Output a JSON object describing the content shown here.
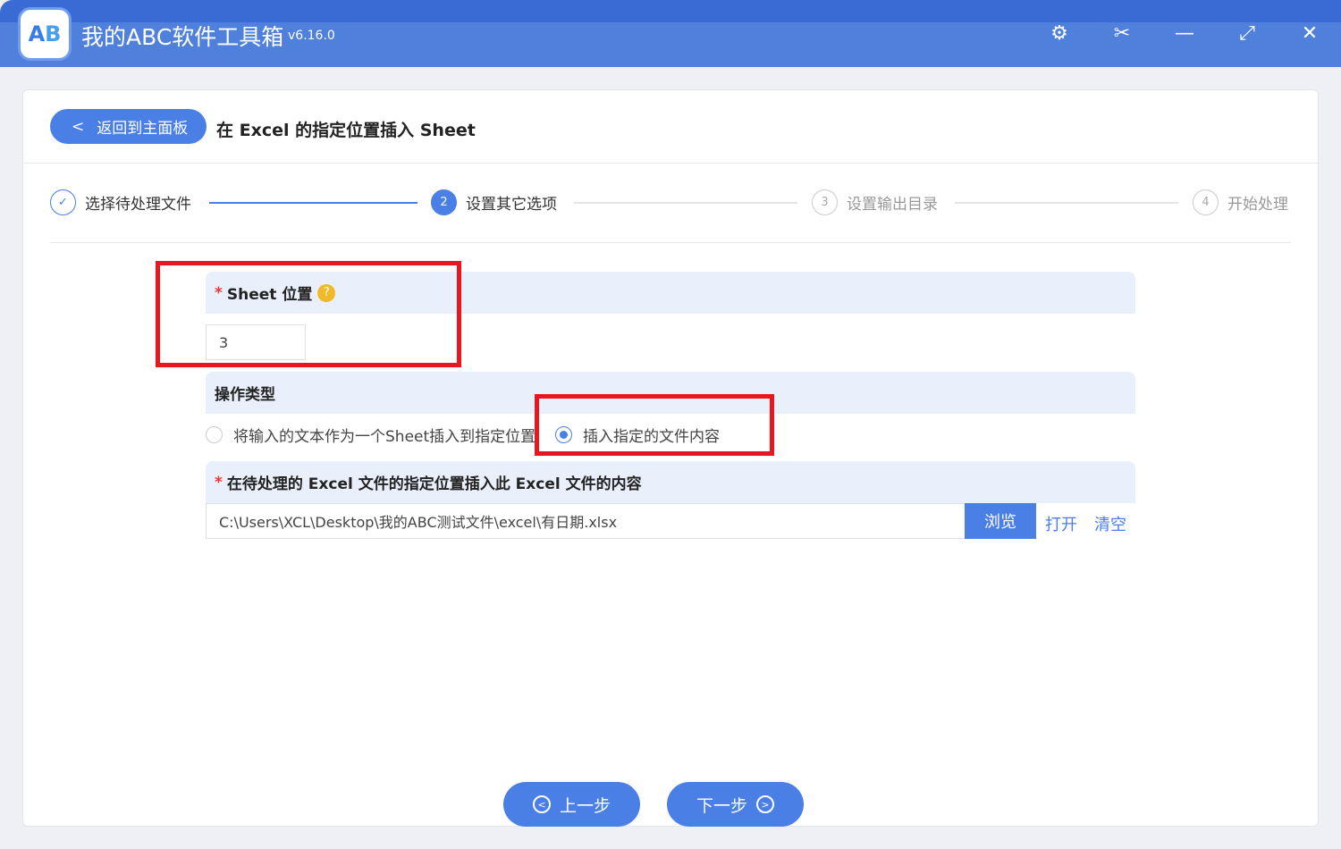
{
  "app": {
    "title": "我的ABC软件工具箱",
    "version": "v6.16.0",
    "logo": "AB"
  },
  "window_controls": [
    "settings-icon",
    "scissors-icon",
    "minimize-icon",
    "maximize-icon",
    "close-icon"
  ],
  "header": {
    "back_label": "返回到主面板",
    "page_title": "在 Excel 的指定位置插入 Sheet"
  },
  "steps": [
    {
      "num": "✓",
      "label": "选择待处理文件",
      "state": "done"
    },
    {
      "num": "2",
      "label": "设置其它选项",
      "state": "active"
    },
    {
      "num": "3",
      "label": "设置输出目录",
      "state": "pending"
    },
    {
      "num": "4",
      "label": "开始处理",
      "state": "pending"
    }
  ],
  "sheet_position": {
    "label": "Sheet 位置",
    "required": "*",
    "help": "?",
    "value": "3"
  },
  "operation": {
    "label": "操作类型",
    "options": [
      "将输入的文本作为一个Sheet插入到指定位置",
      "插入指定的文件内容"
    ],
    "selected": 1
  },
  "file": {
    "required": "*",
    "label": "在待处理的 Excel 文件的指定位置插入此 Excel 文件的内容",
    "value": "C:\\Users\\XCL\\Desktop\\我的ABC测试文件\\excel\\有日期.xlsx",
    "browse": "浏览",
    "open": "打开",
    "clear": "清空"
  },
  "footer": {
    "prev": "上一步",
    "next": "下一步"
  },
  "colors": {
    "accent": "#4a7fe6",
    "highlight": "#e8161f"
  }
}
